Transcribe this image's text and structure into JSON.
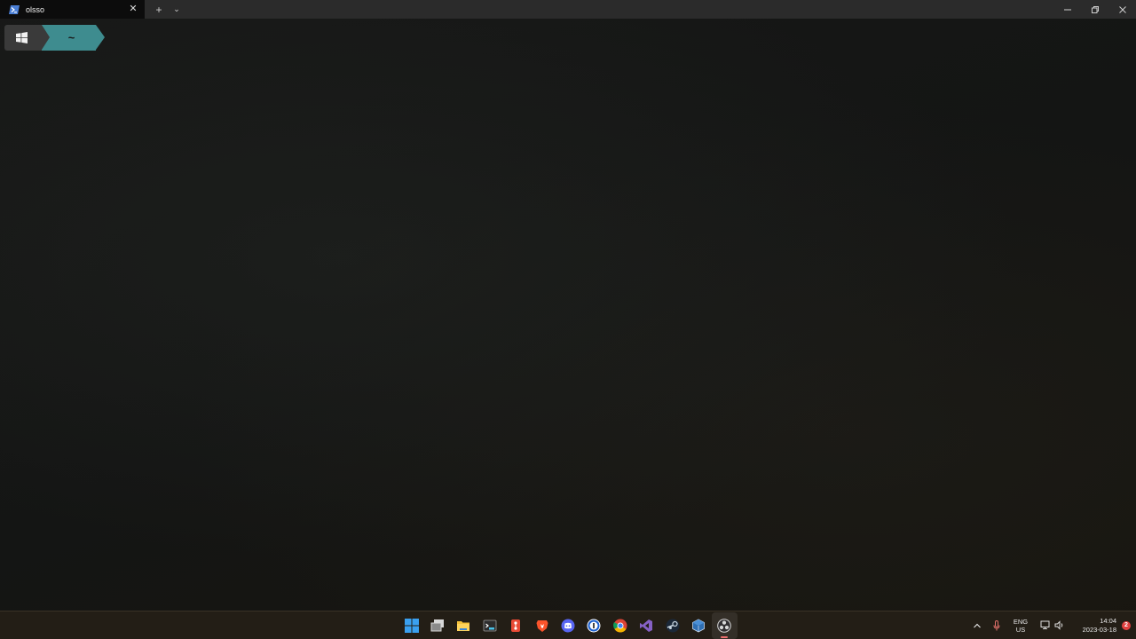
{
  "window": {
    "tab": {
      "title": "olsso",
      "icon": "powershell-icon",
      "close_glyph": "✕"
    },
    "new_tab_glyph": "+",
    "dropdown_glyph": "⌄",
    "controls": [
      "minimize-icon",
      "restore-icon",
      "close-icon"
    ]
  },
  "prompt": {
    "os_icon": "windows-logo-icon",
    "path": "~",
    "colors": {
      "os_segment": "#3a3a3a",
      "path_segment": "#3e8c8f"
    }
  },
  "taskbar": {
    "apps": [
      {
        "name": "start",
        "icon": "windows-start-icon"
      },
      {
        "name": "task-view",
        "icon": "task-view-icon"
      },
      {
        "name": "file-explorer",
        "icon": "folder-icon"
      },
      {
        "name": "terminal",
        "icon": "terminal-icon"
      },
      {
        "name": "git",
        "icon": "git-icon"
      },
      {
        "name": "brave",
        "icon": "brave-lion-icon"
      },
      {
        "name": "discord",
        "icon": "discord-icon"
      },
      {
        "name": "1password",
        "icon": "password-manager-icon"
      },
      {
        "name": "chrome",
        "icon": "chrome-icon"
      },
      {
        "name": "visual-studio",
        "icon": "visual-studio-icon"
      },
      {
        "name": "steam",
        "icon": "steam-icon"
      },
      {
        "name": "virtualbox",
        "icon": "virtualbox-icon"
      },
      {
        "name": "obs",
        "icon": "obs-icon",
        "active": true
      }
    ],
    "tray": {
      "chevron_glyph": "^",
      "language_line1": "ENG",
      "language_line2": "US",
      "time": "14:04",
      "date": "2023-03-18",
      "notification_count": "2"
    }
  }
}
